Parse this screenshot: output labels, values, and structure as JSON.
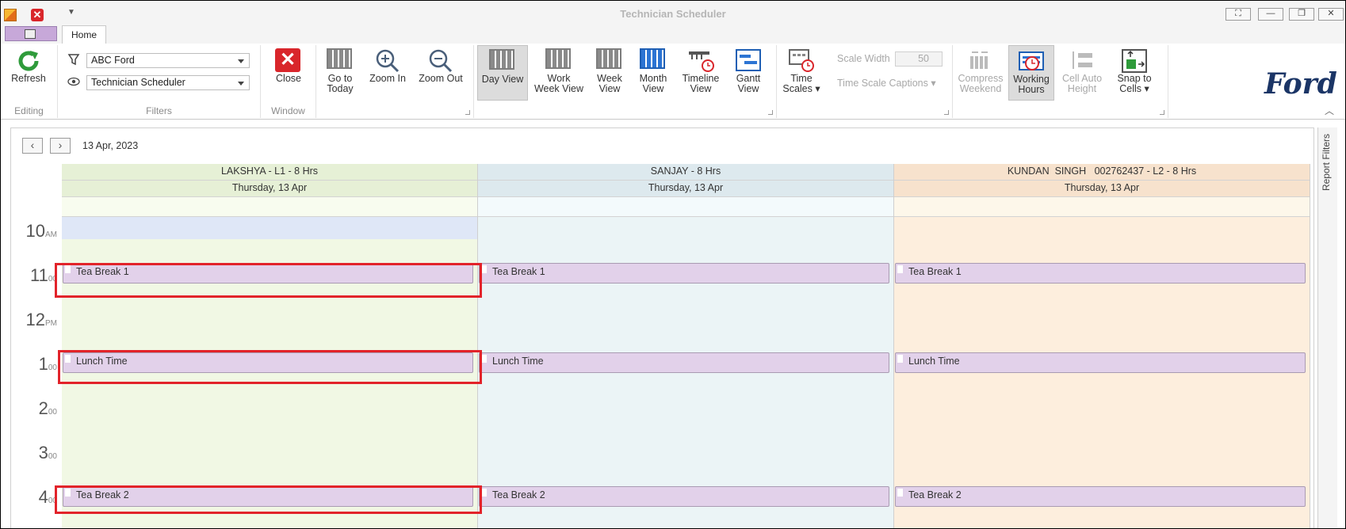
{
  "window": {
    "title": "Technician Scheduler",
    "controls": [
      "fullscreen",
      "minimize",
      "restore",
      "close"
    ]
  },
  "tabs": {
    "home": "Home"
  },
  "ribbon": {
    "editing": {
      "caption": "Editing",
      "refresh": "Refresh"
    },
    "filters": {
      "caption": "Filters",
      "dealer": "ABC Ford",
      "view": "Technician Scheduler"
    },
    "window": {
      "caption": "Window",
      "close": "Close"
    },
    "navigation": {
      "go_to_today": [
        "Go to",
        "Today"
      ],
      "zoom_in": "Zoom In",
      "zoom_out": "Zoom Out"
    },
    "views": {
      "day": "Day View",
      "work_week": [
        "Work",
        "Week View"
      ],
      "week": [
        "Week",
        "View"
      ],
      "month": [
        "Month",
        "View"
      ],
      "timeline": [
        "Timeline",
        "View"
      ],
      "gantt": [
        "Gantt",
        "View"
      ]
    },
    "time_scales": {
      "button": [
        "Time",
        "Scales"
      ],
      "scale_width_label": "Scale Width",
      "scale_width_value": "50",
      "captions": "Time Scale Captions"
    },
    "options": {
      "compress_weekend": [
        "Compress",
        "Weekend"
      ],
      "working_hours": [
        "Working",
        "Hours"
      ],
      "cell_auto_height": [
        "Cell Auto",
        "Height"
      ],
      "snap_to_cells": [
        "Snap to",
        "Cells"
      ]
    },
    "brand": "Ford"
  },
  "scheduler": {
    "date": "13 Apr, 2023",
    "side_panel": "Report Filters",
    "resources": [
      {
        "name": "LAKSHYA - L1 - 8 Hrs",
        "date": "Thursday, 13 Apr",
        "appointments": [
          "Tea Break 1",
          "Lunch Time",
          "Tea Break 2"
        ]
      },
      {
        "name": "SANJAY - 8 Hrs",
        "date": "Thursday, 13 Apr",
        "appointments": [
          "Tea Break 1",
          "Lunch Time",
          "Tea Break 2"
        ]
      },
      {
        "name": "KUNDAN  SINGH   002762437 - L2 - 8 Hrs",
        "date": "Thursday, 13 Apr",
        "appointments": [
          "Tea Break 1",
          "Lunch Time",
          "Tea Break 2"
        ]
      }
    ],
    "time_ruler": [
      {
        "hour": "10",
        "suffix": "AM"
      },
      {
        "hour": "11",
        "suffix": "00"
      },
      {
        "hour": "12",
        "suffix": "PM"
      },
      {
        "hour": "1",
        "suffix": "00"
      },
      {
        "hour": "2",
        "suffix": "00"
      },
      {
        "hour": "3",
        "suffix": "00"
      },
      {
        "hour": "4",
        "suffix": "00"
      }
    ],
    "colors": {
      "lakshya_bg": "#f1f8e4",
      "sanjay_bg": "#ebf4f6",
      "kundan_bg": "#fdeedd",
      "appointment": "#e2d1ea",
      "highlight": "#e2232a"
    }
  }
}
